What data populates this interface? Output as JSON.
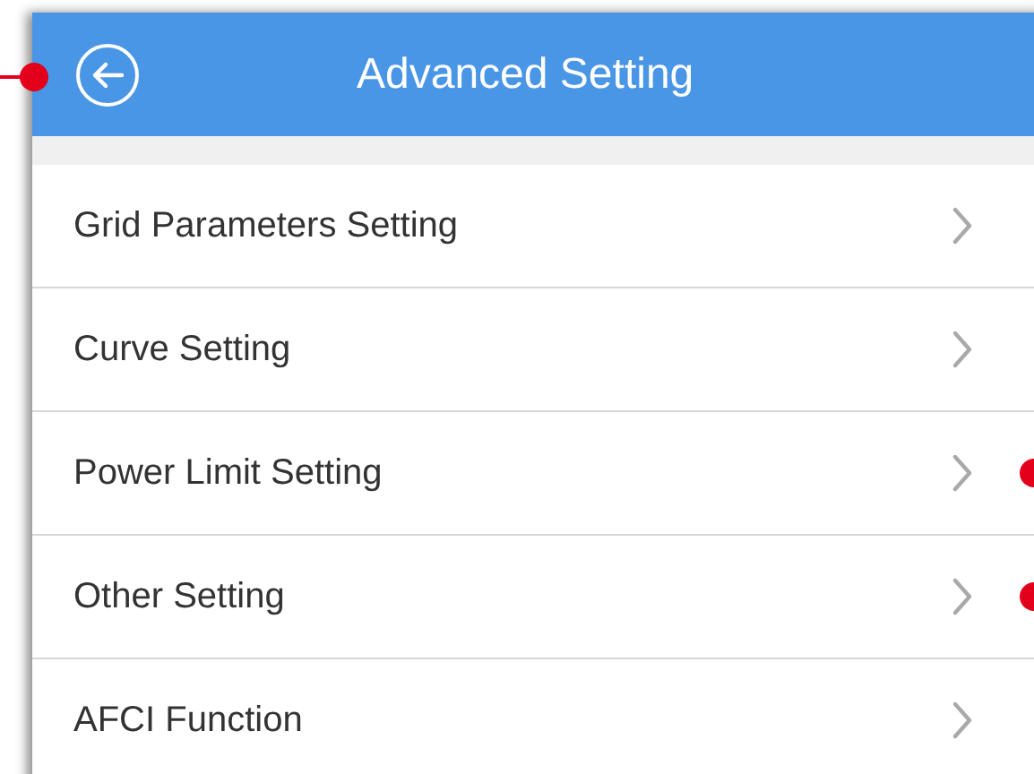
{
  "header": {
    "title": "Advanced Setting",
    "annotated": true
  },
  "items": [
    {
      "label": "Grid Parameters Setting",
      "annotated": false
    },
    {
      "label": "Curve Setting",
      "annotated": false
    },
    {
      "label": "Power Limit Setting",
      "annotated": true
    },
    {
      "label": "Other Setting",
      "annotated": true
    },
    {
      "label": "AFCI Function",
      "annotated": false
    }
  ]
}
